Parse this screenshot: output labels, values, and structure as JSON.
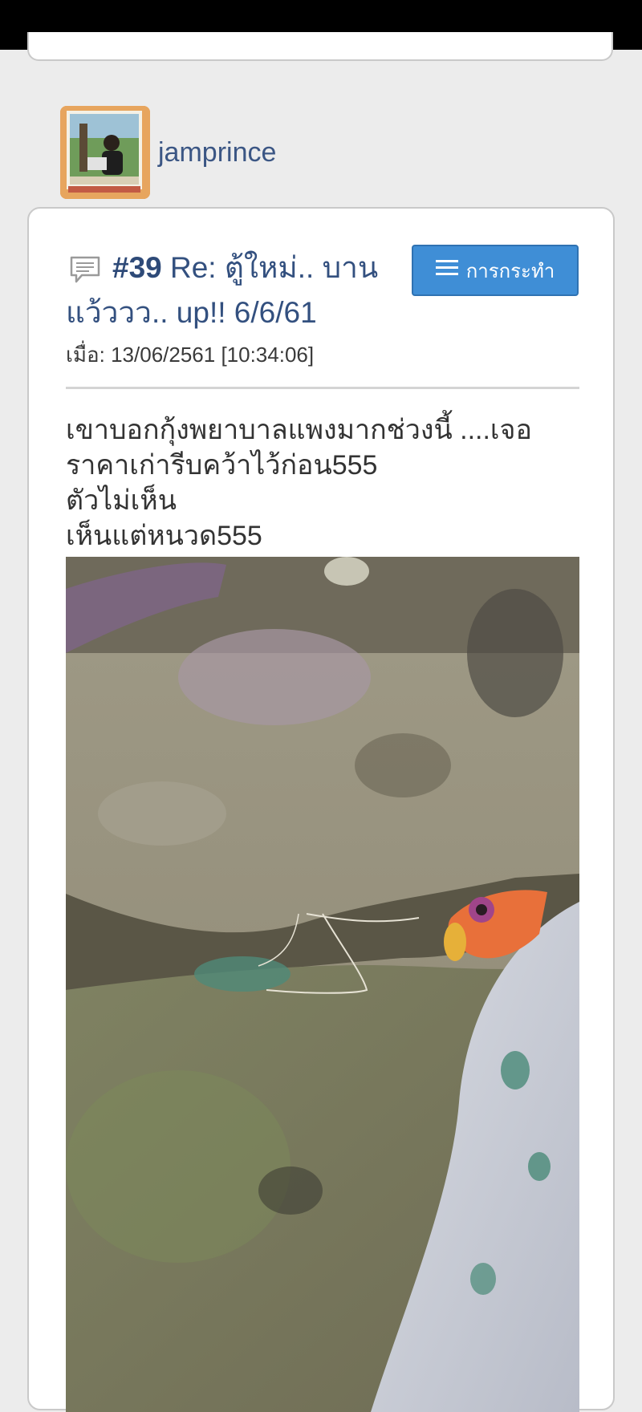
{
  "author": {
    "name": "jamprince"
  },
  "post": {
    "icon": "comment-icon",
    "number": "#39",
    "title": " Re: ตู้ใหม่.. บานแว้ววว.. up!! 6/6/61",
    "date": "เมื่อ: 13/06/2561 [10:34:06]",
    "action": {
      "label": "การกระทำ",
      "icon": "menu-icon"
    },
    "body_lines": [
      "เขาบอกกุ้งพยาบาลแพงมากช่วงนี้ ....เจอ",
      "ราคาเก่ารีบคว้าไว้ก่อน555",
      "ตัวไม่เห็น",
      "เห็นแต่หนวด555"
    ]
  },
  "colors": {
    "accent_button": "#3f8ed6",
    "title_text": "#33507f",
    "background": "#ececec"
  }
}
